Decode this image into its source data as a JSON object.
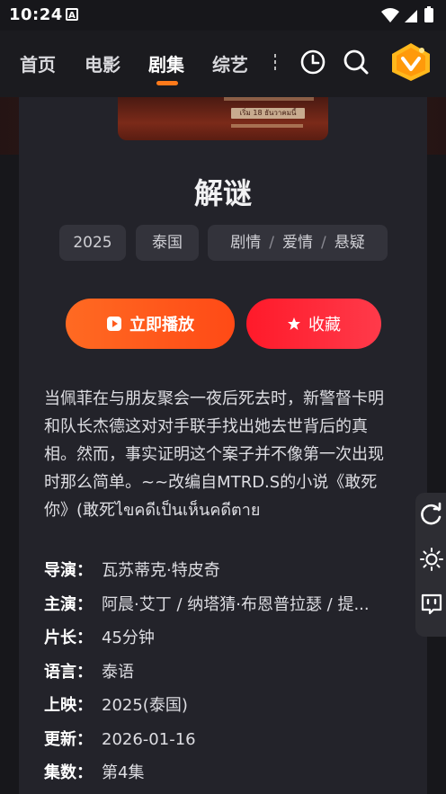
{
  "status_bar": {
    "time": "10:24",
    "notification_letter": "A"
  },
  "nav": {
    "items": [
      {
        "label": "首页",
        "active": false
      },
      {
        "label": "电影",
        "active": false
      },
      {
        "label": "剧集",
        "active": true
      },
      {
        "label": "综艺",
        "active": false
      }
    ],
    "icons": [
      "history-icon",
      "search-icon",
      "vip-badge-icon"
    ],
    "accent": "#ff7a1a"
  },
  "show": {
    "poster_date_text": "เริ่ม 18 ธันวาคมนี้",
    "title": "解谜",
    "tags": {
      "year": "2025",
      "region": "泰国",
      "genres": [
        "剧情",
        "爱情",
        "悬疑"
      ]
    },
    "play_button": "立即播放",
    "favorite_button": "收藏",
    "description": "当佩菲在与朋友聚会一夜后死去时，新警督卡明和队长杰德这对对手联手找出她去世背后的真相。然而，事实证明这个案子并不像第一次出现时那么简单。~~改编自MTRD.S的小说《敢死你》(敢死ไขคดีเป็นเห็นคดีตาย",
    "meta": [
      {
        "key": "导演：",
        "value": "瓦苏蒂克·特皮奇"
      },
      {
        "key": "主演：",
        "value": "阿晨·艾丁  /  纳塔猜·布恩普拉瑟  /  提..."
      },
      {
        "key": "片长：",
        "value": "45分钟"
      },
      {
        "key": "语言：",
        "value": "泰语"
      },
      {
        "key": "上映：",
        "value": "2025(泰国)"
      },
      {
        "key": "更新：",
        "value": "2026-01-16"
      },
      {
        "key": "集数：",
        "value": "第4集"
      }
    ]
  },
  "side_tools": [
    "refresh-icon",
    "brightness-icon",
    "danmaku-icon"
  ],
  "colors": {
    "play": "#ff5a1c",
    "favorite": "#ff2a3a",
    "card": "#23232a"
  }
}
